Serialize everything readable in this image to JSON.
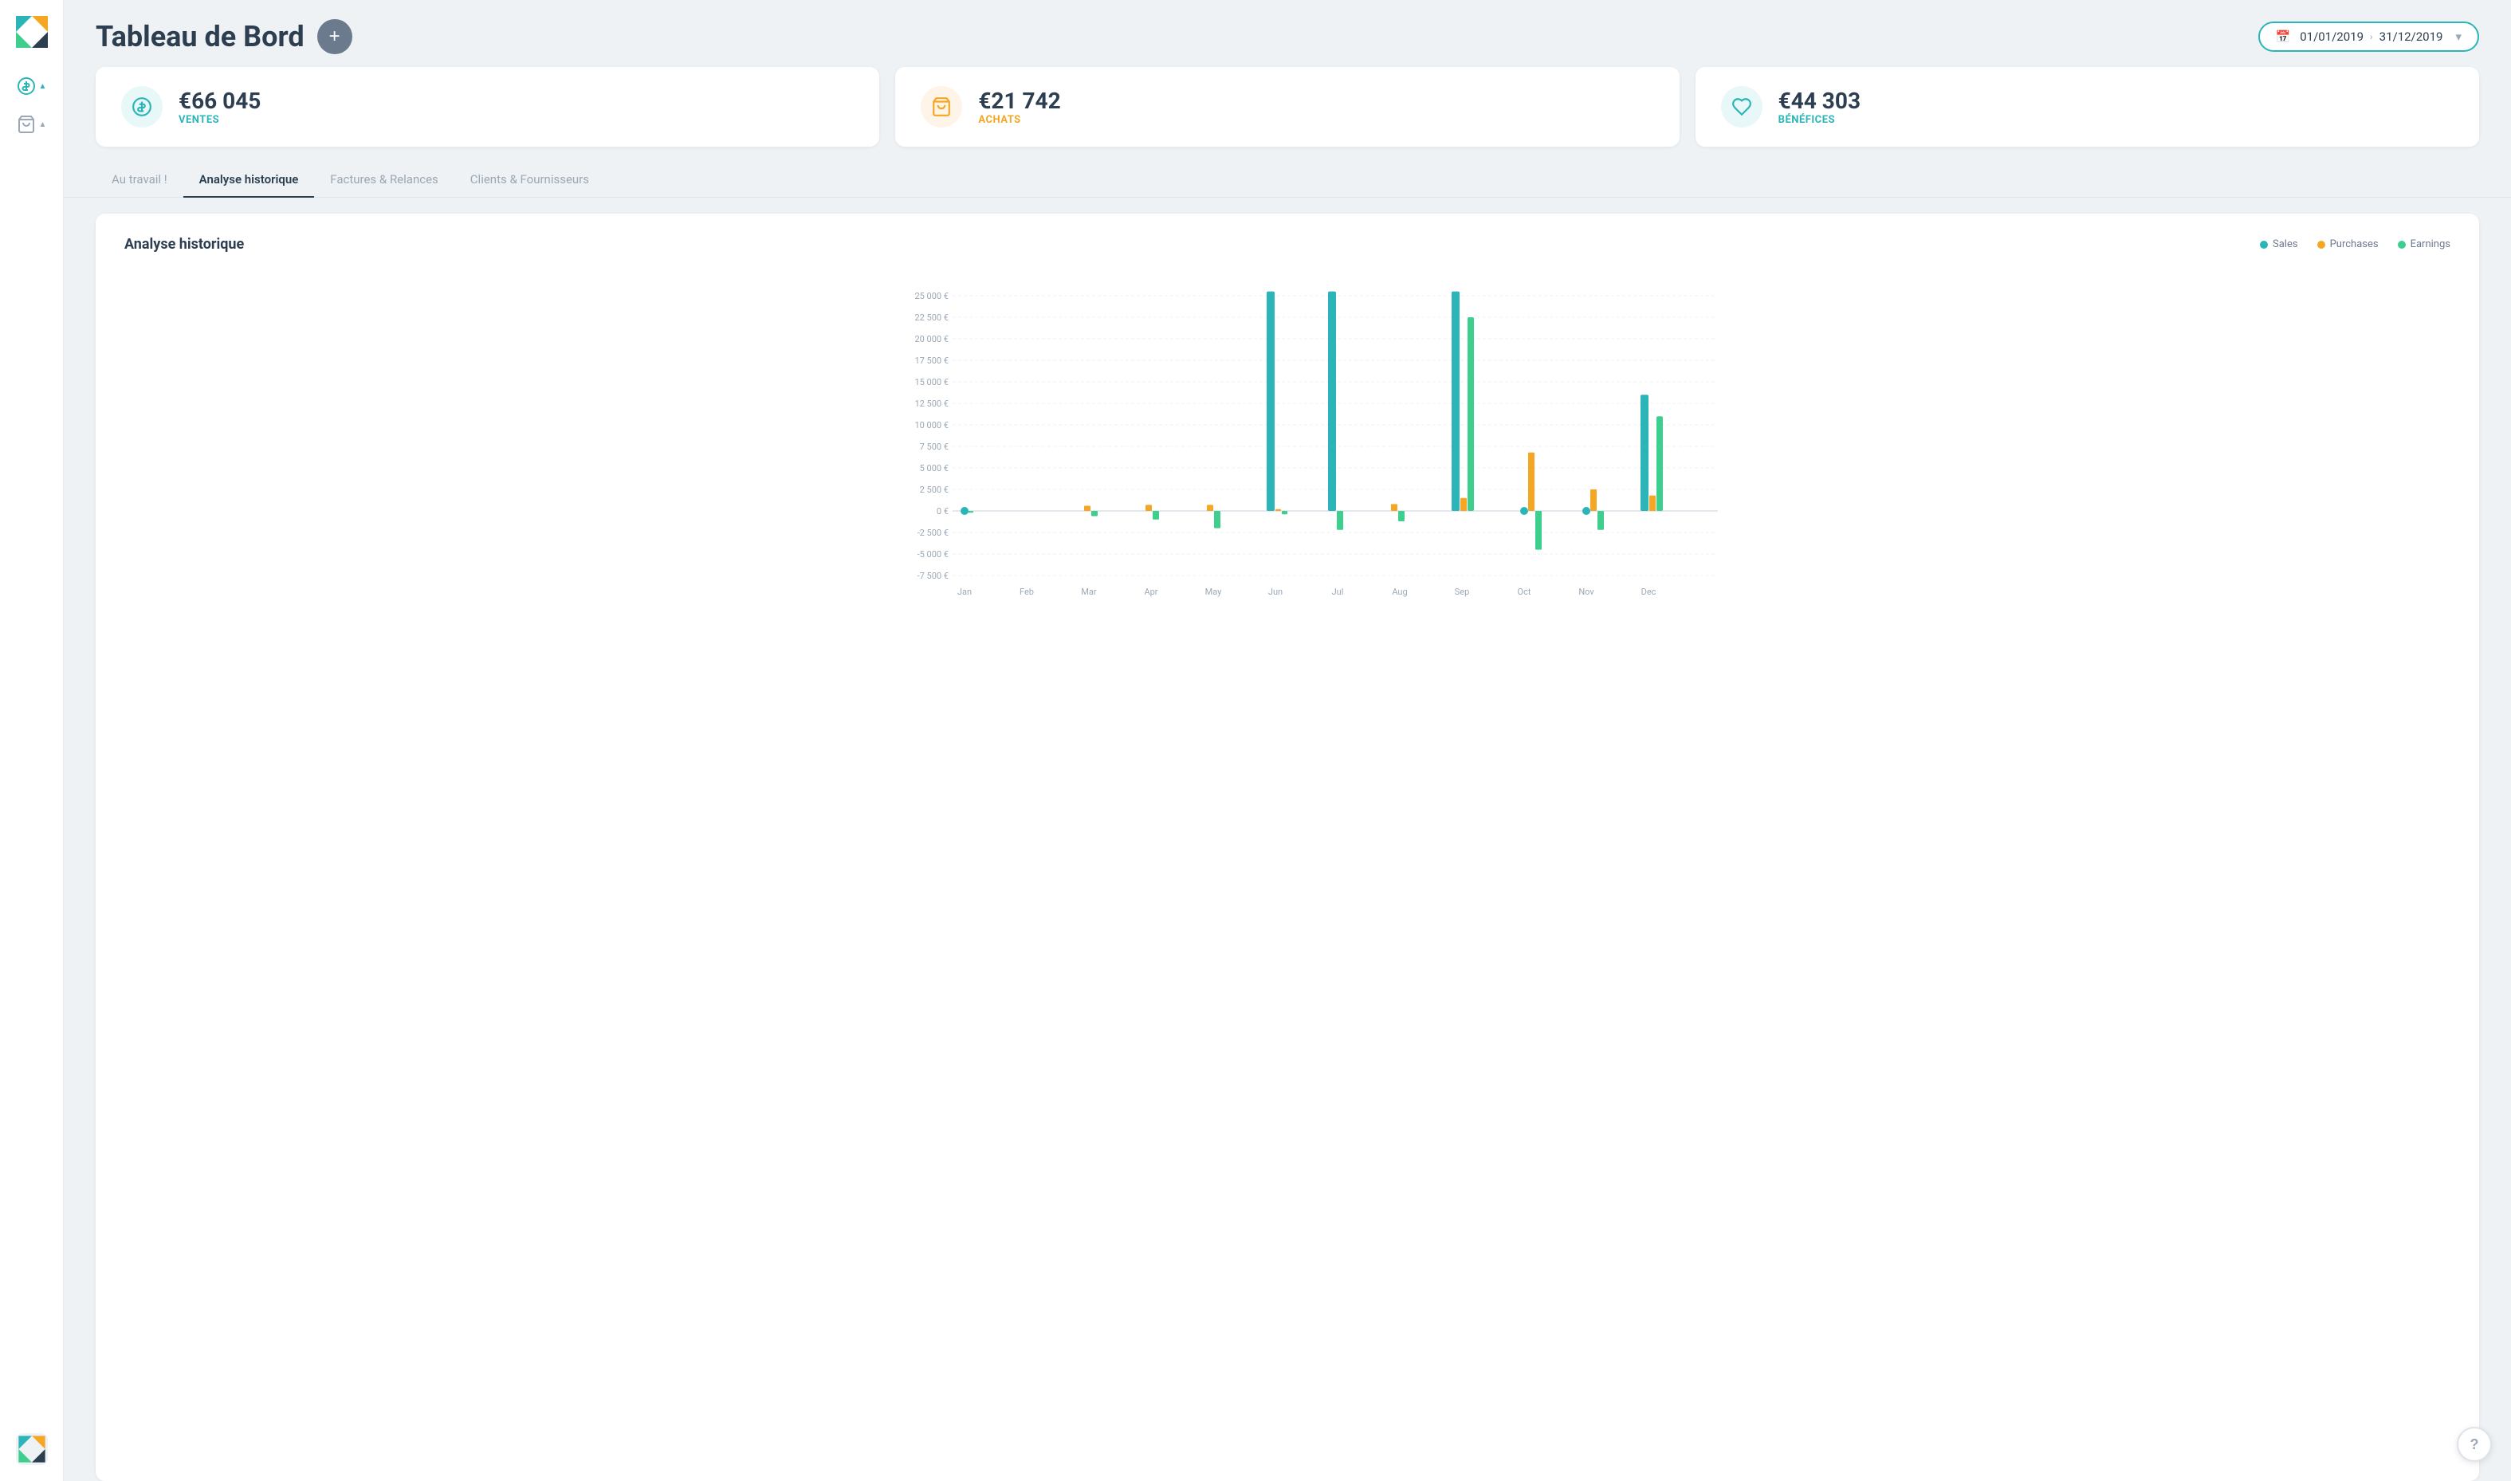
{
  "app": {
    "title": "Tableau de Bord"
  },
  "header": {
    "title": "Tableau de Bord",
    "add_button_label": "+",
    "date_start": "01/01/2019",
    "date_end": "31/12/2019"
  },
  "kpis": [
    {
      "id": "ventes",
      "value": "€66 045",
      "label": "VENTES",
      "icon": "dollar-icon",
      "color": "teal"
    },
    {
      "id": "achats",
      "value": "€21 742",
      "label": "ACHATS",
      "icon": "cart-icon",
      "color": "orange"
    },
    {
      "id": "benefices",
      "value": "€44 303",
      "label": "BÉNÉFICES",
      "icon": "piggy-icon",
      "color": "blue-green"
    }
  ],
  "tabs": [
    {
      "id": "au-travail",
      "label": "Au travail !"
    },
    {
      "id": "analyse-historique",
      "label": "Analyse historique",
      "active": true
    },
    {
      "id": "factures-relances",
      "label": "Factures & Relances"
    },
    {
      "id": "clients-fournisseurs",
      "label": "Clients & Fournisseurs"
    }
  ],
  "chart": {
    "title": "Analyse historique",
    "legend": [
      {
        "label": "Sales",
        "color": "#2bb5b8"
      },
      {
        "label": "Purchases",
        "color": "#f5a623"
      },
      {
        "label": "Earnings",
        "color": "#3ecf8e"
      }
    ],
    "y_labels": [
      "25 000 €",
      "22 500 €",
      "20 000 €",
      "17 500 €",
      "15 000 €",
      "12 500 €",
      "10 000 €",
      "7 500 €",
      "5 000 €",
      "2 500 €",
      "0 €",
      "-2 500 €",
      "-5 000 €",
      "-7 500 €"
    ],
    "months": [
      "Jan",
      "Feb",
      "Mar",
      "Apr",
      "May",
      "Jun",
      "Jul",
      "Aug",
      "Sep",
      "Oct",
      "Nov",
      "Dec"
    ],
    "bars": [
      {
        "month": "Jan",
        "sales": 0,
        "purchases": 0,
        "earnings": -200
      },
      {
        "month": "Feb",
        "sales": 0,
        "purchases": 0,
        "earnings": 0
      },
      {
        "month": "Mar",
        "sales": 0,
        "purchases": 600,
        "earnings": -600
      },
      {
        "month": "Apr",
        "sales": 0,
        "purchases": 700,
        "earnings": -1000
      },
      {
        "month": "May",
        "sales": 0,
        "purchases": 700,
        "earnings": -2000
      },
      {
        "month": "Jun",
        "sales": 25500,
        "purchases": 200,
        "earnings": -400
      },
      {
        "month": "Jul",
        "sales": 25500,
        "purchases": 0,
        "earnings": -2200
      },
      {
        "month": "Aug",
        "sales": 0,
        "purchases": 800,
        "earnings": -1200
      },
      {
        "month": "Sep",
        "sales": 25500,
        "purchases": 1500,
        "earnings": 22500
      },
      {
        "month": "Oct",
        "sales": 200,
        "purchases": 6800,
        "earnings": -4500
      },
      {
        "month": "Nov",
        "sales": 200,
        "purchases": 2500,
        "earnings": -2200
      },
      {
        "month": "Dec",
        "sales": 13500,
        "purchases": 1800,
        "earnings": 11000
      }
    ]
  },
  "sidebar": {
    "items": [
      {
        "id": "dollar",
        "icon": "dollar-circle-icon",
        "active": true
      },
      {
        "id": "cart",
        "icon": "cart-icon",
        "active": false
      }
    ]
  },
  "help_button_label": "?"
}
